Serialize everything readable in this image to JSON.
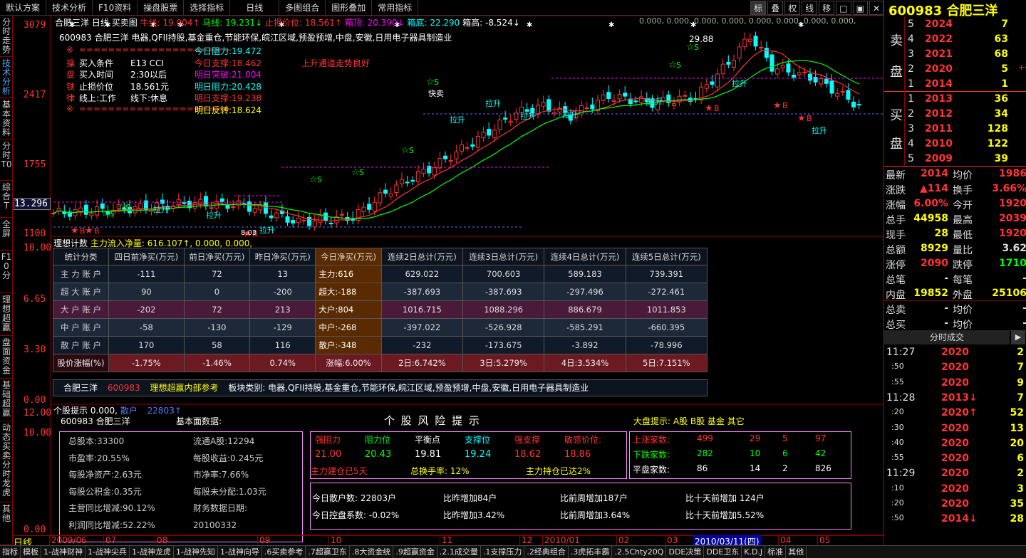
{
  "menubar": {
    "items": [
      "默认方案",
      "技术分析",
      "F10资料",
      "操盘股票",
      "选择指标",
      "日线",
      "多图组合",
      "图形叠加",
      "常用指标"
    ],
    "tools": [
      "标",
      "叠",
      "权",
      "线",
      "移"
    ]
  },
  "leftnav": [
    "分时走势",
    "技术分析",
    "基本资料",
    "分时T0",
    "综合T",
    "全屏",
    "F10分",
    "理想超赢",
    "盘面资金",
    "基础超赢",
    "动态买卖",
    "分时龙虎",
    "其他"
  ],
  "chart": {
    "header_name": "合肥三洋",
    "header_period": "日线",
    "header_type": "买卖图",
    "ma_line": "牛线: 19.004↑",
    "horse_line": "马线: 19.231↓",
    "stop_price": "止损价位: 18.561↑",
    "box_top": "箱顶: 20.390↓",
    "box_bottom": "箱底: 22.290",
    "box_high": "箱高: -8.524↓",
    "extra_vals": "0.000, 0.000, 0.000, 0.000, 0.000, 0.000, 0.000, 0.000,",
    "stock_line": "600983 合肥三洋 电器,QFII持股,基金重仓,节能环保,皖江区域,预盈预增,中盘,安徽,日用电子器具制造业",
    "left_box": [
      [
        "※",
        "=====================",
        ""
      ],
      [
        "操",
        "买入条件",
        "E13 CCI"
      ],
      [
        "盘",
        "买入时间",
        "2:30以后"
      ],
      [
        "铁",
        "止损价位",
        "18.561元"
      ],
      [
        "律",
        "线上:工作",
        "线下:休息"
      ],
      [
        "※",
        "=====================",
        ""
      ]
    ],
    "mid_box": [
      {
        "label": "今日阻力:",
        "value": "19.472",
        "color": "cyan"
      },
      {
        "label": "今日支撑:",
        "value": "18.462",
        "color": "red"
      },
      {
        "label": "明日突破:",
        "value": "21.004",
        "color": "magenta"
      },
      {
        "label": "明日阻力:",
        "value": "20.428",
        "color": "cyan"
      },
      {
        "label": "明日支撑:",
        "value": "19.238",
        "color": "red"
      },
      {
        "label": "明日反转:",
        "value": "18.624",
        "color": "yellow"
      }
    ],
    "trend_text": "上升通道走势良好",
    "y_labels": [
      "3079",
      "2417",
      "1755",
      "13.296",
      "1100"
    ],
    "peak_label": "29.88",
    "low_label": "8.03",
    "annotations": {
      "kuaimai": "快卖",
      "lashang": "拉升",
      "buy": "B",
      "sell": "S"
    }
  },
  "dde": {
    "title": "理想计数",
    "flow": "主力流入净量: 616.107↑, 0.000, 0.000,",
    "y_labels": [
      "10.00",
      "6.65",
      "3.30",
      "0.00"
    ],
    "headers": [
      "统计分类",
      "四日前净买(万元)",
      "前日净买(万元)",
      "昨日净买(万元)",
      "今日净买(万元)",
      "连续2日总计(万元)",
      "连续3日总计(万元)",
      "连续4日总计(万元)",
      "连续5日总计(万元)"
    ],
    "rows": [
      [
        "主 力 账 户",
        "-111",
        "72",
        "13",
        "主力:616",
        "629.022",
        "700.603",
        "589.183",
        "739.391"
      ],
      [
        "超 大 账 户",
        "90",
        "0",
        "-200",
        "超大:-188",
        "-387.693",
        "-387.693",
        "-297.496",
        "-272.461"
      ],
      [
        "大 户 账 户",
        "-202",
        "72",
        "213",
        "大户:804",
        "1016.715",
        "1088.296",
        "886.679",
        "1011.853"
      ],
      [
        "中 户 账 户",
        "-58",
        "-130",
        "-129",
        "中户:-268",
        "-397.022",
        "-526.928",
        "-585.291",
        "-660.395"
      ],
      [
        "散 户 账 户",
        "170",
        "58",
        "116",
        "散户:-348",
        "-232",
        "-173.675",
        "-3.892",
        "-78.996"
      ],
      [
        "股价涨幅(%)",
        "-1.75%",
        "-1.46%",
        "0.74%",
        "涨幅:6.00%",
        "2日:6.742%",
        "3日:5.279%",
        "4日:3.534%",
        "5日:7.151%"
      ]
    ],
    "footer": {
      "name": "合肥三洋",
      "code": "600983",
      "tip": "理想超赢内部参考",
      "sector": "板块类别: 电器,QFII持股,基金重仓,节能环保,皖江区域,预盈预增,中盘,安徽,日用电子器具制造业"
    }
  },
  "risk": {
    "tip_line": "个股提示 0.000,",
    "retail": "散户",
    "retail_val": "22803↑",
    "y_labels": [
      "12.00",
      "10.00",
      "0.00"
    ],
    "code_name": "600983 合肥三洋",
    "basic_label": "基本面数据:",
    "title": "个 股 风 险 提 示",
    "market_tip": "大盘提示:  A股  B股  基金  其它",
    "fund": [
      [
        "总股本:33300",
        "流通A股:12294"
      ],
      [
        "市盈率:20.55%",
        "每股收益:0.245元"
      ],
      [
        "每股净资产:2.63元",
        "市净率:7.66%"
      ],
      [
        "每股公积金:0.35元",
        "每股未分配:1.03元"
      ],
      [
        "主营同比增减:90.12%",
        "财务数据日期:"
      ],
      [
        "利润同比增减:52.22%",
        "20100332"
      ]
    ],
    "levels": {
      "headers": [
        "强阻力",
        "阻力位",
        "平衡点",
        "支撑位",
        "强支撑",
        "敏感价位:"
      ],
      "values": [
        "21.00",
        "20.43",
        "19.81",
        "19.24",
        "18.62",
        "18.86"
      ],
      "main_build": "主力建仓已5天",
      "turnover": "总换手率: 12%",
      "main_hold": "主力持仓已达2%"
    },
    "market": {
      "rows": [
        [
          "上涨家数:",
          "499",
          "29",
          "5",
          "97"
        ],
        [
          "下跌家数:",
          "282",
          "10",
          "6",
          "42"
        ],
        [
          "平盘家数:",
          "86",
          "14",
          "2",
          "826"
        ]
      ]
    },
    "retail_info": [
      [
        "今日散户数: 22803户",
        "比昨增加84户",
        "比前周增加187户",
        "比十天前增加 124户"
      ],
      [
        "今日控盘系数: -0.02%",
        "比昨增加3.42%",
        "比前周增加3.64%",
        "比十天前增加5.52%"
      ]
    ]
  },
  "timeaxis": {
    "period": "日线",
    "labels": [
      "2009/06",
      "07",
      "08",
      "09",
      "10",
      "11",
      "12",
      "2010/01",
      "02",
      "03",
      "04",
      "05"
    ],
    "cursor": "2010/03/11(四)"
  },
  "bottom": [
    "指标",
    "模板",
    "1-战神财神",
    "1-战神尖兵",
    "1-战神龙虎",
    "1-战神先知",
    "1-战神向导",
    ".6买卖参考",
    ".7超赢卫东",
    ".8大资金统",
    ".9超赢资金",
    ".2.1成交量",
    ".1支撑压力",
    ".2经典组合",
    ".3虎拓丰霸",
    ".2.5Chty20Q",
    "DDE决策",
    "DDE卫东",
    "K.D.J",
    "标准",
    "其他"
  ],
  "quote": {
    "code": "600983",
    "name": "合肥三洋",
    "sell": [
      [
        "5",
        "2024",
        "7"
      ],
      [
        "4",
        "2022",
        "63"
      ],
      [
        "3",
        "2021",
        "68"
      ],
      [
        "2",
        "2020",
        "5"
      ],
      [
        "1",
        "2014",
        "1"
      ]
    ],
    "sell_extra": "+4",
    "buy": [
      [
        "1",
        "2013",
        "36"
      ],
      [
        "2",
        "2012",
        "34"
      ],
      [
        "3",
        "2011",
        "128"
      ],
      [
        "4",
        "2010",
        "122"
      ],
      [
        "5",
        "2009",
        "39"
      ]
    ],
    "stats": [
      [
        "最新",
        "2014",
        "均价",
        "1986"
      ],
      [
        "涨跌",
        "▲114",
        "换手",
        "3.66%"
      ],
      [
        "涨幅",
        "6.00%",
        "今开",
        "1920"
      ],
      [
        "总手",
        "44958",
        "最高",
        "2039"
      ],
      [
        "现手",
        "28",
        "最低",
        "1920"
      ],
      [
        "总额",
        "8929",
        "量比",
        "3.62"
      ],
      [
        "涨停",
        "2090",
        "跌停",
        "1710"
      ],
      [
        "总笔",
        "-",
        "每笔",
        "-"
      ],
      [
        "内盘",
        "19852",
        "外盘",
        "25106"
      ],
      [
        "总卖",
        "-",
        "均价",
        "-"
      ],
      [
        "总买",
        "-",
        "均价",
        "-"
      ]
    ],
    "ticks_title": "分时成交",
    "ticks": [
      [
        "11:27",
        "2020",
        "2"
      ],
      [
        ":50",
        "2020",
        "7"
      ],
      [
        ":55",
        "2020",
        "9"
      ],
      [
        "11:28",
        "2013↓",
        "7"
      ],
      [
        ":20",
        "2020↑",
        "52"
      ],
      [
        ":30",
        "2020",
        "13"
      ],
      [
        ":40",
        "2020",
        "20"
      ],
      [
        ":55",
        "2020",
        "6"
      ],
      [
        "11:29",
        "2020",
        "2"
      ],
      [
        ":10",
        "2020",
        "3"
      ],
      [
        ":20",
        "2020",
        "35"
      ],
      [
        ":50",
        "2014↓",
        "28"
      ]
    ],
    "bottom_label": "细"
  }
}
